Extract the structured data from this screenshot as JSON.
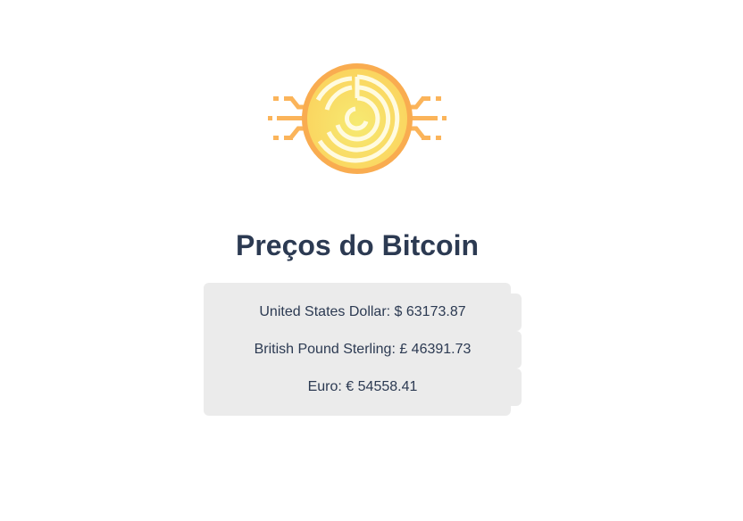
{
  "logo": {
    "icon": "bitcoin-maze-coin-icon",
    "colors": {
      "ring": "#f9ac50",
      "fill": "#f8ec7a"
    }
  },
  "title": "Preços do Bitcoin",
  "prices": [
    {
      "label": "United States Dollar: $ 63173.87"
    },
    {
      "label": "British Pound Sterling: £ 46391.73"
    },
    {
      "label": "Euro: € 54558.41"
    }
  ]
}
